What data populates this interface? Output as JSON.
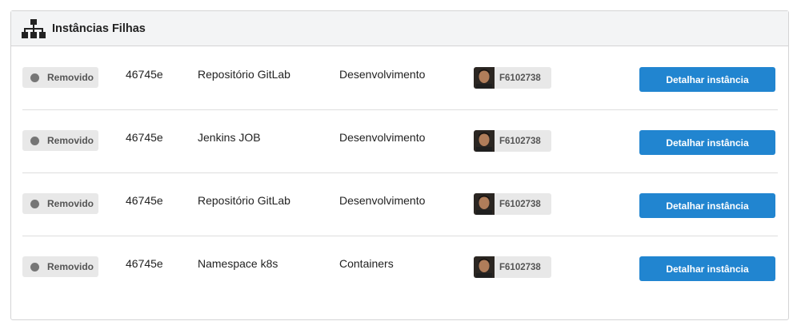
{
  "panel": {
    "title": "Instâncias Filhas",
    "icon": "sitemap-icon"
  },
  "rows": [
    {
      "status": "Removido",
      "id": "46745e",
      "name": "Repositório GitLab",
      "environment": "Desenvolvimento",
      "user": "F6102738",
      "button": "Detalhar instância"
    },
    {
      "status": "Removido",
      "id": "46745e",
      "name": "Jenkins JOB",
      "environment": "Desenvolvimento",
      "user": "F6102738",
      "button": "Detalhar instância"
    },
    {
      "status": "Removido",
      "id": "46745e",
      "name": "Repositório GitLab",
      "environment": "Desenvolvimento",
      "user": "F6102738",
      "button": "Detalhar instância"
    },
    {
      "status": "Removido",
      "id": "46745e",
      "name": "Namespace k8s",
      "environment": "Containers",
      "user": "F6102738",
      "button": "Detalhar instância"
    }
  ],
  "colors": {
    "button": "#2185d0",
    "badge_bg": "#e8e8e8",
    "status_dot": "#767676"
  }
}
